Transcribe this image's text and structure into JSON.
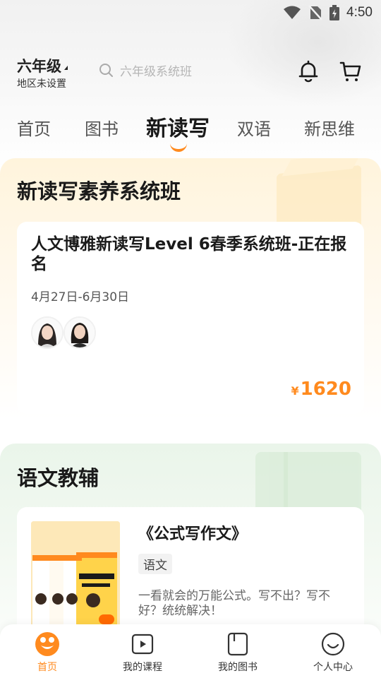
{
  "status_bar": {
    "time": "4:50"
  },
  "header": {
    "grade": "六年级",
    "region": "地区未设置",
    "search_placeholder": "六年级系统班"
  },
  "tabs": [
    {
      "label": "首页"
    },
    {
      "label": "图书"
    },
    {
      "label": "新读写"
    },
    {
      "label": "双语"
    },
    {
      "label": "新思维"
    }
  ],
  "active_tab": "新读写",
  "section1": {
    "title": "新读写素养系统班",
    "course": {
      "title": "人文博雅新读写Level 6春季系统班-正在报名",
      "date": "4月27日-6月30日",
      "price_symbol": "¥",
      "price": "1620"
    }
  },
  "section2": {
    "title": "语文教辅",
    "book": {
      "title": "《公式写作文》",
      "tag": "语文",
      "description": "一看就会的万能公式。写不出？写不好？统统解决！"
    }
  },
  "bottom_nav": [
    {
      "label": "首页",
      "icon": "home-icon"
    },
    {
      "label": "我的课程",
      "icon": "play-icon"
    },
    {
      "label": "我的图书",
      "icon": "book-icon"
    },
    {
      "label": "个人中心",
      "icon": "smile-icon"
    }
  ],
  "colors": {
    "accent": "#ff8a1e",
    "section1_bg": "#fff4dc",
    "section2_bg": "#eaf5ea"
  }
}
